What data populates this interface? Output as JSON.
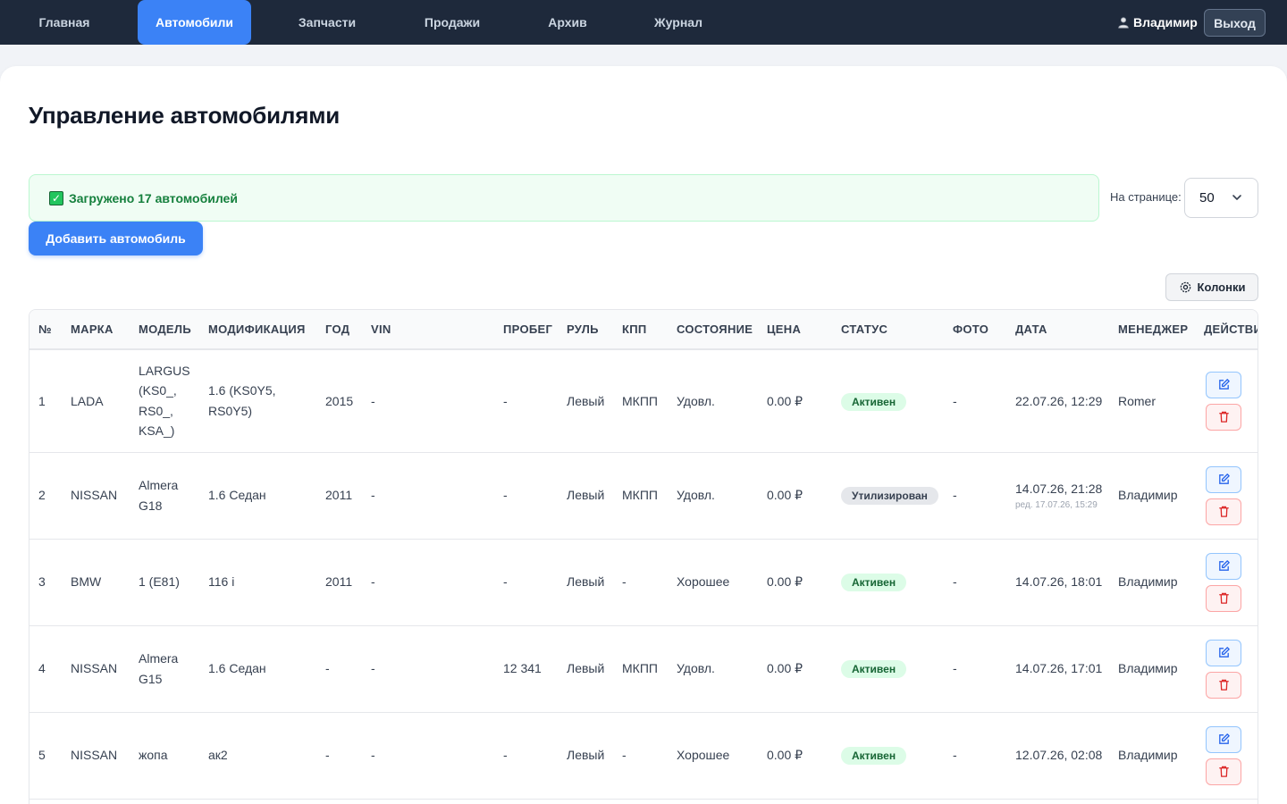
{
  "nav": {
    "items": [
      {
        "label": "Главная",
        "name": "nav-home"
      },
      {
        "label": "Автомобили",
        "name": "nav-cars"
      },
      {
        "label": "Запчасти",
        "name": "nav-parts"
      },
      {
        "label": "Продажи",
        "name": "nav-sales"
      },
      {
        "label": "Архив",
        "name": "nav-archive"
      },
      {
        "label": "Журнал",
        "name": "nav-log"
      }
    ],
    "active": "Автомобили",
    "user_icon": "user-icon",
    "user": "Владимир",
    "logout": "Выход"
  },
  "page": {
    "title": "Управление автомобилями",
    "alert_icon": "check-icon",
    "alert_text": "Загружено 17 автомобилей",
    "per_page_label": "На странице:",
    "per_page_value": "50",
    "add_button": "Добавить автомобиль",
    "columns_icon": "gear-icon",
    "columns_button": "Колонки"
  },
  "table": {
    "columns": [
      "№",
      "МАРКА",
      "МОДЕЛЬ",
      "МОДИФИКАЦИЯ",
      "ГОД",
      "VIN",
      "ПРОБЕГ",
      "РУЛЬ",
      "КПП",
      "СОСТОЯНИЕ",
      "ЦЕНА",
      "СТАТУС",
      "ФОТО",
      "ДАТА",
      "МЕНЕДЖЕР",
      "ДЕЙСТВИЯ"
    ],
    "rows": [
      {
        "num": "1",
        "make": "LADA",
        "model": "LARGUS (KS0_, RS0_, KSA_)",
        "mod": "1.6 (KS0Y5, RS0Y5)",
        "year": "2015",
        "vin": "-",
        "mileage": "-",
        "wheel": "Левый",
        "gearbox": "МКПП",
        "condition": "Удовл.",
        "price": "0.00 ₽",
        "status": "Активен",
        "status_kind": "active",
        "photo": "-",
        "date": "22.07.26, 12:29",
        "date_sub": "",
        "manager": "Romer"
      },
      {
        "num": "2",
        "make": "NISSAN",
        "model": "Almera G18",
        "mod": "1.6 Седан",
        "year": "2011",
        "vin": "-",
        "mileage": "-",
        "wheel": "Левый",
        "gearbox": "МКПП",
        "condition": "Удовл.",
        "price": "0.00 ₽",
        "status": "Утилизирован",
        "status_kind": "util",
        "photo": "-",
        "date": "14.07.26, 21:28",
        "date_sub": "ред. 17.07.26, 15:29",
        "manager": "Владимир"
      },
      {
        "num": "3",
        "make": "BMW",
        "model": "1 (E81)",
        "mod": "116 i",
        "year": "2011",
        "vin": "-",
        "mileage": "-",
        "wheel": "Левый",
        "gearbox": "-",
        "condition": "Хорошее",
        "price": "0.00 ₽",
        "status": "Активен",
        "status_kind": "active",
        "photo": "-",
        "date": "14.07.26, 18:01",
        "date_sub": "",
        "manager": "Владимир"
      },
      {
        "num": "4",
        "make": "NISSAN",
        "model": "Almera G15",
        "mod": "1.6 Седан",
        "year": "-",
        "vin": "-",
        "mileage": "12 341",
        "wheel": "Левый",
        "gearbox": "МКПП",
        "condition": "Удовл.",
        "price": "0.00 ₽",
        "status": "Активен",
        "status_kind": "active",
        "photo": "-",
        "date": "14.07.26, 17:01",
        "date_sub": "",
        "manager": "Владимир"
      },
      {
        "num": "5",
        "make": "NISSAN",
        "model": "жопа",
        "mod": "ак2",
        "year": "-",
        "vin": "-",
        "mileage": "-",
        "wheel": "Левый",
        "gearbox": "-",
        "condition": "Хорошее",
        "price": "0.00 ₽",
        "status": "Активен",
        "status_kind": "active",
        "photo": "-",
        "date": "12.07.26, 02:08",
        "date_sub": "",
        "manager": "Владимир"
      }
    ],
    "edit_icon": "edit-icon",
    "delete_icon": "trash-icon"
  }
}
